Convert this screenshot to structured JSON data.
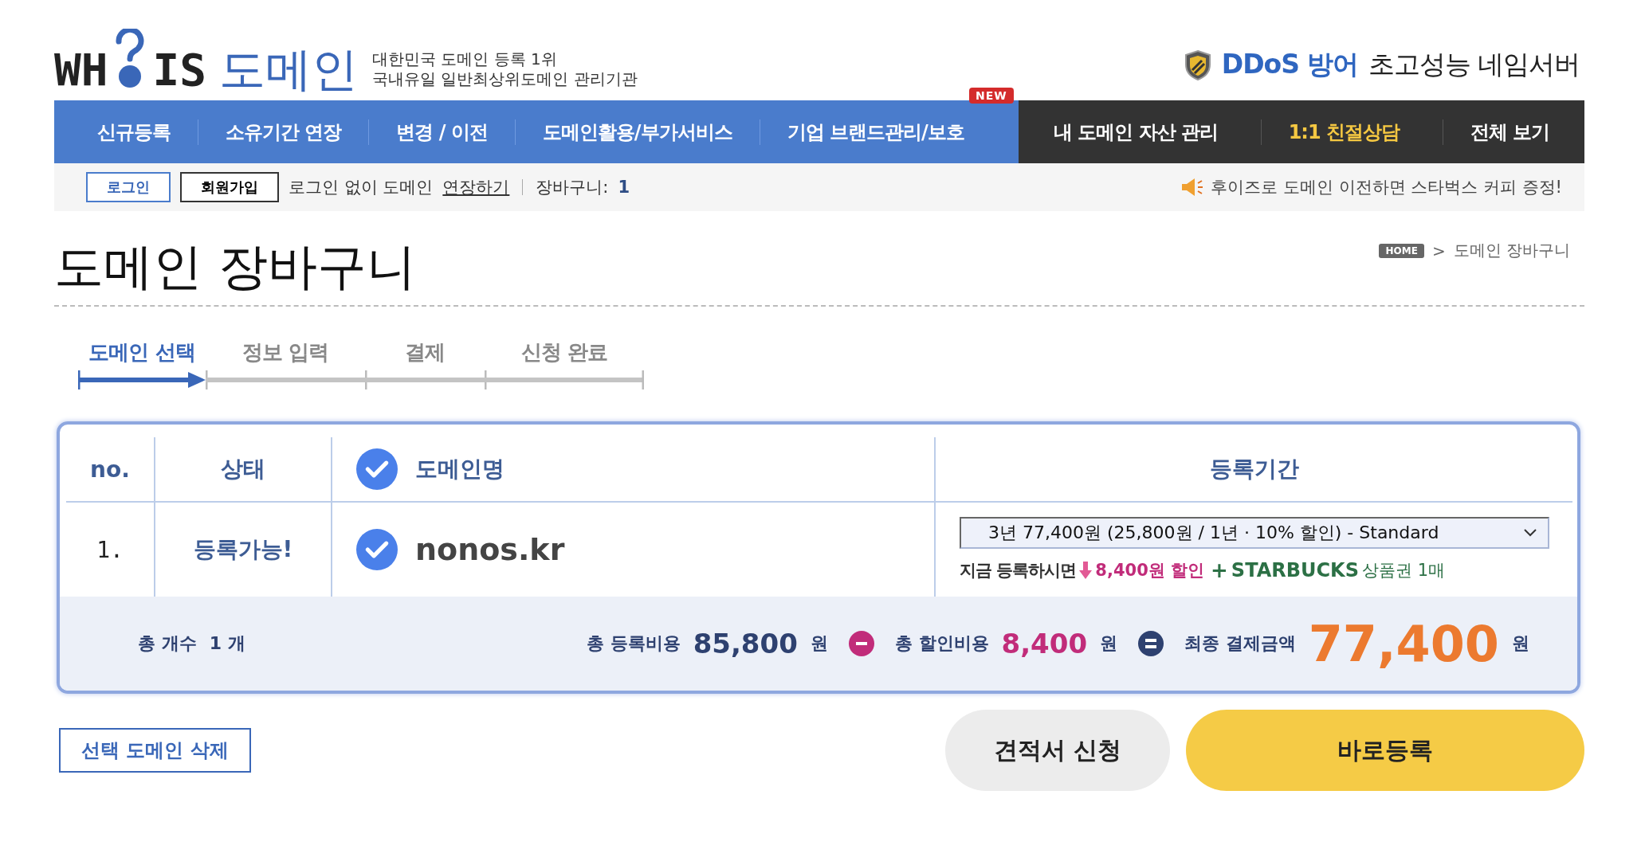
{
  "logo": {
    "left": "WH",
    "right": "IS",
    "word": "도메인",
    "tagline": [
      "대한민국 도메인 등록 1위",
      "국내유일 일반최상위도메인 관리기관"
    ]
  },
  "ddos": {
    "highlight": "DDoS 방어",
    "text": "초고성능 네임서버"
  },
  "nav_main": [
    {
      "label": "신규등록"
    },
    {
      "label": "소유기간 연장"
    },
    {
      "label": "변경 / 이전"
    },
    {
      "label": "도메인활용/부가서비스"
    },
    {
      "label": "기업 브랜드관리/보호",
      "badge": "NEW"
    }
  ],
  "nav_side": [
    {
      "label": "내 도메인 자산 관리",
      "kind": "normal"
    },
    {
      "label": "1:1 친절상담",
      "kind": "highlight"
    },
    {
      "label": "전체 보기",
      "kind": "normal"
    }
  ],
  "subbar": {
    "login": "로그인",
    "signup": "회원가입",
    "note": "로그인 없이 도메인",
    "link": "연장하기",
    "cart_label": "장바구니:",
    "cart_count": "1",
    "promo": "후이즈로 도메인 이전하면 스타벅스 커피 증정!"
  },
  "page_title": "도메인 장바구니",
  "breadcrumb": {
    "home": "HOME",
    "separator": ">",
    "current": "도메인 장바구니"
  },
  "steps": [
    {
      "label": "도메인 선택",
      "selected": true
    },
    {
      "label": "정보 입력",
      "selected": false
    },
    {
      "label": "결제",
      "selected": false
    },
    {
      "label": "신청 완료",
      "selected": false
    }
  ],
  "table": {
    "columns": [
      "no.",
      "상태",
      "도메인명",
      "등록기간"
    ],
    "header_checked": true,
    "rows": [
      {
        "no": "1.",
        "status": "등록가능!",
        "checked": true,
        "domain": "nonos.kr",
        "period": "3년 77,400원 (25,800원 / 1년 · 10% 할인) - Standard",
        "promo": {
          "lead": "지금 등록하시면",
          "discount": "8,400원 할인",
          "plus": "+",
          "brand": "STARBUCKS",
          "gift": "상품권 1매"
        }
      }
    ]
  },
  "summary": {
    "count_label": "총 개수",
    "count": "1 개",
    "total_label": "총 등록비용",
    "total": "85,800",
    "total_unit": "원",
    "discount_label": "총 할인비용",
    "discount": "8,400",
    "discount_unit": "원",
    "final_label": "최종 결제금액",
    "final": "77,400",
    "final_unit": "원"
  },
  "buttons": {
    "delete": "선택 도메인 삭제",
    "quote": "견적서 신청",
    "register": "바로등록"
  }
}
